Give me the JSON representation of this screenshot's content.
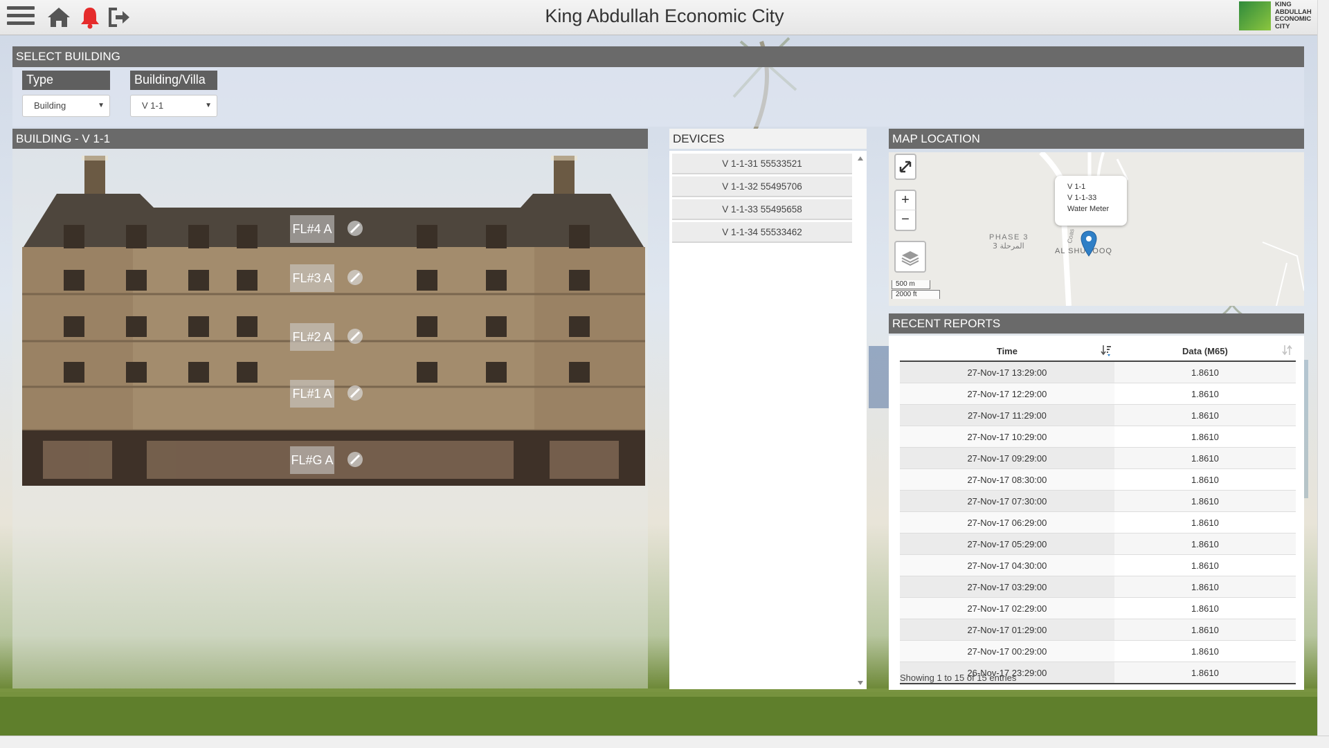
{
  "header": {
    "title": "King Abdullah Economic City",
    "brand_lines": [
      "KING",
      "ABDULLAH",
      "ECONOMIC",
      "CITY"
    ],
    "alert_color": "#e52b2b"
  },
  "select_building": {
    "title": "SELECT BUILDING",
    "type_label": "Type",
    "type_value": "Building",
    "building_label": "Building/Villa",
    "building_value": "V 1-1"
  },
  "building": {
    "title": "BUILDING - V 1-1",
    "floors": [
      "FL#4 A",
      "FL#3 A",
      "FL#2 A",
      "FL#1 A",
      "FL#G A"
    ]
  },
  "devices": {
    "title": "DEVICES",
    "items": [
      "V 1-1-31 55533521",
      "V 1-1-32 55495706",
      "V 1-1-33 55495658",
      "V 1-1-34 55533462"
    ]
  },
  "map": {
    "title": "MAP LOCATION",
    "popup": [
      "V 1-1",
      "V 1-1-33",
      "Water Meter"
    ],
    "labels": {
      "phase": "PHASE 3",
      "phase_ar": "المرحلة 3",
      "area": "AL SHUROOQ",
      "road": "Coas"
    },
    "scale_m": "500 m",
    "scale_ft": "2000 ft",
    "zoom_in": "+",
    "zoom_out": "−",
    "marker_color": "#2f7fc6"
  },
  "reports": {
    "title": "RECENT REPORTS",
    "columns": [
      "Time",
      "Data (M65)"
    ],
    "rows": [
      [
        "27-Nov-17 13:29:00",
        "1.8610"
      ],
      [
        "27-Nov-17 12:29:00",
        "1.8610"
      ],
      [
        "27-Nov-17 11:29:00",
        "1.8610"
      ],
      [
        "27-Nov-17 10:29:00",
        "1.8610"
      ],
      [
        "27-Nov-17 09:29:00",
        "1.8610"
      ],
      [
        "27-Nov-17 08:30:00",
        "1.8610"
      ],
      [
        "27-Nov-17 07:30:00",
        "1.8610"
      ],
      [
        "27-Nov-17 06:29:00",
        "1.8610"
      ],
      [
        "27-Nov-17 05:29:00",
        "1.8610"
      ],
      [
        "27-Nov-17 04:30:00",
        "1.8610"
      ],
      [
        "27-Nov-17 03:29:00",
        "1.8610"
      ],
      [
        "27-Nov-17 02:29:00",
        "1.8610"
      ],
      [
        "27-Nov-17 01:29:00",
        "1.8610"
      ],
      [
        "27-Nov-17 00:29:00",
        "1.8610"
      ],
      [
        "26-Nov-17 23:29:00",
        "1.8610"
      ]
    ],
    "info": "Showing 1 to 15 of 15 entries"
  }
}
